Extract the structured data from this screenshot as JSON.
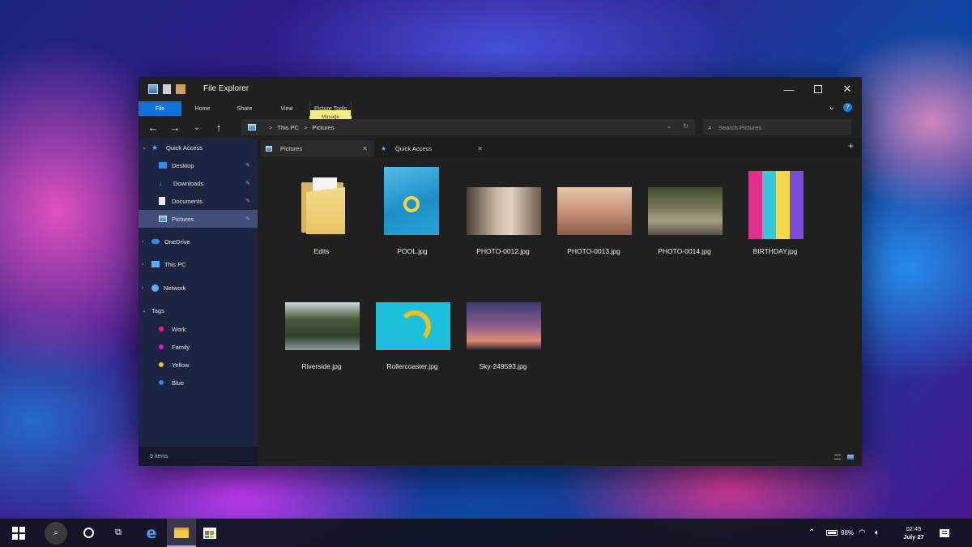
{
  "window": {
    "title": "File Explorer",
    "ribbon": {
      "tabs": [
        "File",
        "Home",
        "Share",
        "View",
        "Picture Tools"
      ],
      "contextual_badge": "Manage",
      "help": "?"
    },
    "nav": {
      "back": "←",
      "forward": "→",
      "recent": "⌄",
      "up": "↑"
    },
    "address": {
      "breadcrumb": [
        "This PC",
        "Pictures"
      ],
      "separator": ">"
    },
    "search": {
      "placeholder": "Search Pictures",
      "icon": "search-icon"
    }
  },
  "sidebar": {
    "quick_access": {
      "label": "Quick Access",
      "items": [
        {
          "label": "Desktop",
          "icon": "desktop-icon",
          "pinned": true
        },
        {
          "label": "Downloads",
          "icon": "download-icon",
          "pinned": true
        },
        {
          "label": "Documents",
          "icon": "document-icon",
          "pinned": true
        },
        {
          "label": "Pictures",
          "icon": "pictures-icon",
          "pinned": true,
          "selected": true
        }
      ]
    },
    "onedrive": "OneDrive",
    "this_pc": "This PC",
    "network": "Network",
    "tags": {
      "label": "Tags",
      "items": [
        {
          "label": "Work",
          "color": "#e91e8c"
        },
        {
          "label": "Family",
          "color": "#d21ed8"
        },
        {
          "label": "Yellow",
          "color": "#f2c12e"
        },
        {
          "label": "Blue",
          "color": "#2e8ae6"
        }
      ]
    },
    "status": "9 items"
  },
  "tabs": [
    {
      "label": "Pictures",
      "icon": "pictures-icon",
      "active": true
    },
    {
      "label": "Quick Access",
      "icon": "star-icon",
      "active": false
    }
  ],
  "files": [
    {
      "name": "Edits",
      "type": "folder"
    },
    {
      "name": "POOL.jpg",
      "type": "image",
      "colors": [
        "#2aa1d6",
        "#68c7ea"
      ]
    },
    {
      "name": "PHOTO-0012.jpg",
      "type": "image",
      "colors": [
        "#6a5a4a",
        "#c9b7a0"
      ]
    },
    {
      "name": "PHOTO-0013.jpg",
      "type": "image",
      "colors": [
        "#8a5e4a",
        "#d9b49a"
      ]
    },
    {
      "name": "PHOTO-0014.jpg",
      "type": "image",
      "colors": [
        "#3f4a2c",
        "#a7a184"
      ]
    },
    {
      "name": "BIRTHDAY.jpg",
      "type": "image",
      "colors": [
        "#e0308c",
        "#38c7d9"
      ]
    },
    {
      "name": "Riverside.jpg",
      "type": "image",
      "colors": [
        "#2f3f2a",
        "#8a9a9e"
      ]
    },
    {
      "name": "Rollercoaster.jpg",
      "type": "image",
      "colors": [
        "#1cc0da",
        "#f0c020"
      ]
    },
    {
      "name": "Sky-249593.jpg",
      "type": "image",
      "colors": [
        "#3c3a72",
        "#e08a74"
      ]
    }
  ],
  "taskbar": {
    "battery": "98%",
    "time": "02:45",
    "date": "July 27"
  }
}
